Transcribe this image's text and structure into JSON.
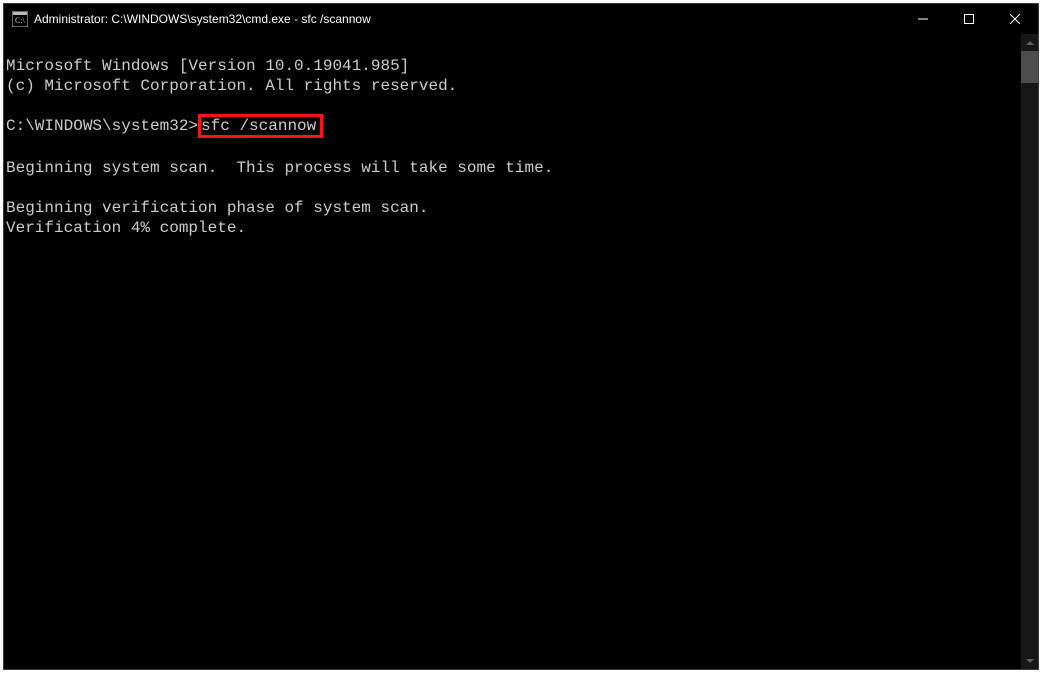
{
  "window": {
    "title": "Administrator: C:\\WINDOWS\\system32\\cmd.exe - sfc  /scannow"
  },
  "terminal": {
    "line1": "Microsoft Windows [Version 10.0.19041.985]",
    "line2": "(c) Microsoft Corporation. All rights reserved.",
    "blank1": "",
    "prompt_prefix": "C:\\WINDOWS\\system32>",
    "command": "sfc /scannow",
    "blank2": "",
    "line3": "Beginning system scan.  This process will take some time.",
    "blank3": "",
    "line4": "Beginning verification phase of system scan.",
    "line5": "Verification 4% complete."
  }
}
